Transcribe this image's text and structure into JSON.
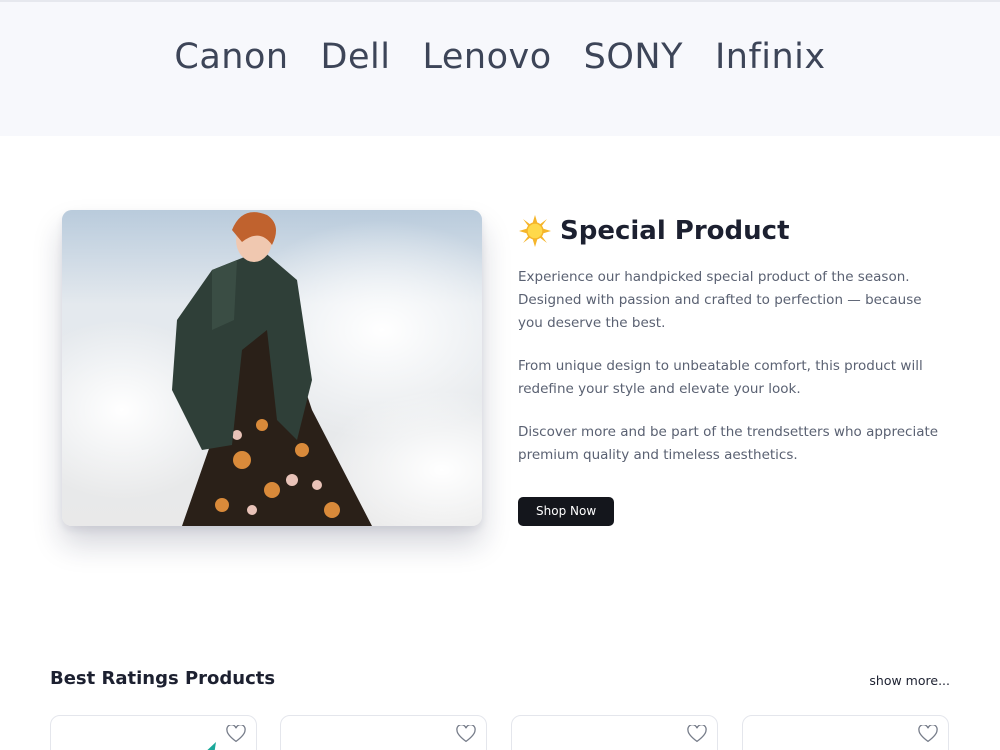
{
  "brands": [
    "Canon",
    "Dell",
    "Lenovo",
    "SONY",
    "Infinix"
  ],
  "special": {
    "icon": "sun-emoji-icon",
    "title": "Special Product",
    "paragraphs": [
      "Experience our handpicked special product of the season. Designed with passion and crafted to perfection — because you deserve the best.",
      "From unique design to unbeatable comfort, this product will redefine your style and elevate your look.",
      "Discover more and be part of the trendsetters who appreciate premium quality and timeless aesthetics."
    ],
    "button_label": "Shop Now"
  },
  "best_ratings": {
    "title": "Best Ratings Products",
    "show_more": "show more...",
    "cards": [
      {
        "icon": "heart-outline-icon",
        "accent": "#1aa89a"
      },
      {
        "icon": "heart-outline-icon",
        "accent": "#8a2b6c"
      },
      {
        "icon": "heart-outline-icon",
        "accent": "#3c3f48"
      },
      {
        "icon": "heart-outline-icon",
        "accent": "#b0245e"
      }
    ]
  },
  "colors": {
    "brand_text": "#3d4558",
    "button_bg": "#14161c",
    "body_text": "#5a6172"
  }
}
